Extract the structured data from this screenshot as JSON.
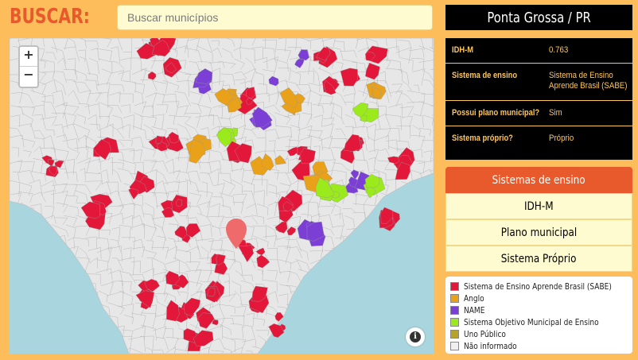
{
  "search": {
    "label": "BUSCAR:",
    "placeholder": "Buscar municípios",
    "value": ""
  },
  "map": {
    "zoom_in": "+",
    "zoom_out": "−",
    "info": "i",
    "colors": {
      "sea": "#a9d5df",
      "land": "#e7e7e7",
      "border": "#b5b5b5",
      "marker": "#ef6b6b"
    }
  },
  "details": {
    "title": "Ponta Grossa / PR",
    "rows": [
      {
        "key": "IDH-M",
        "value": "0.763"
      },
      {
        "key": "Sistema de ensino",
        "value_lines": [
          "Sistema de Ensino",
          "Aprende Brasil (SABE)"
        ]
      },
      {
        "key": "Possui plano municipal?",
        "value": "Sim"
      },
      {
        "key": "Sistema próprio?",
        "value": "Próprio"
      }
    ]
  },
  "tabs": [
    {
      "label": "Sistemas de ensino",
      "active": true
    },
    {
      "label": "IDH-M",
      "active": false
    },
    {
      "label": "Plano municipal",
      "active": false
    },
    {
      "label": "Sistema Próprio",
      "active": false
    }
  ],
  "legend": [
    {
      "label": "Sistema de Ensino Aprende Brasil (SABE)",
      "color": "#e3173a"
    },
    {
      "label": "Anglo",
      "color": "#e8a119"
    },
    {
      "label": "NAME",
      "color": "#7b3fd6"
    },
    {
      "label": "Sistema Objetivo Municipal de Ensino",
      "color": "#9bea1c"
    },
    {
      "label": "Uno Público",
      "color": "#b7a22a"
    },
    {
      "label": "Não informado",
      "color": "#f0f0f0"
    }
  ]
}
